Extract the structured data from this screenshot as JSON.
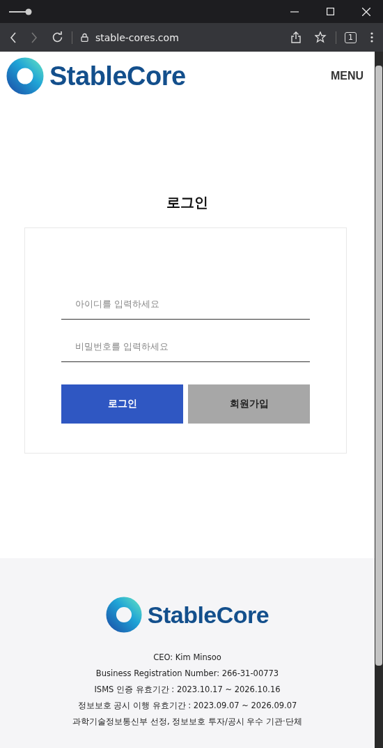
{
  "browser": {
    "url": "stable-cores.com",
    "tab_count": "1"
  },
  "header": {
    "brand": "StableCore",
    "menu": "MENU"
  },
  "login": {
    "title": "로그인",
    "fields": [
      {
        "placeholder": "아이디를 입력하세요"
      },
      {
        "placeholder": "비밀번호를 입력하세요"
      }
    ],
    "buttons": [
      {
        "label": "로그인",
        "kind": "primary"
      },
      {
        "label": "회원가입",
        "kind": "secondary"
      }
    ]
  },
  "footer": {
    "brand": "StableCore",
    "lines": [
      "CEO: Kim Minsoo",
      "Business Registration Number: 266-31-00773",
      "ISMS 인증 유효기간 : 2023.10.17 ~ 2026.10.16",
      "정보보호 공시 이행 유효기간 : 2023.09.07 ~ 2026.09.07",
      "과학기술정보통신부 선정, 정보보호 투자/공시 우수 기관·단체"
    ]
  }
}
